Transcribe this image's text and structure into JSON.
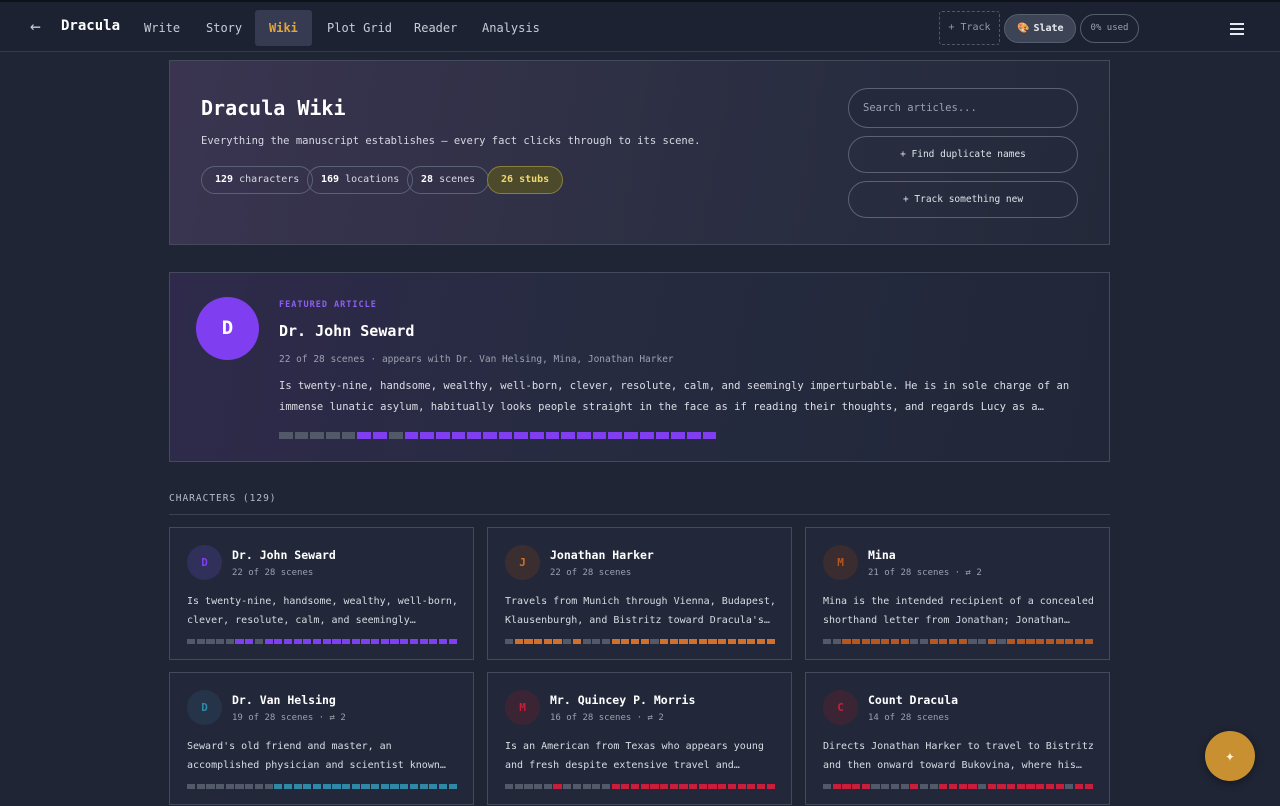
{
  "topbar": {
    "back_glyph": "←",
    "title": "Dracula",
    "tabs": [
      {
        "label": "Write",
        "active": false
      },
      {
        "label": "Story",
        "active": false
      },
      {
        "label": "Wiki",
        "active": true
      },
      {
        "label": "Plot Grid",
        "active": false
      },
      {
        "label": "Reader",
        "active": false
      },
      {
        "label": "Analysis",
        "active": false
      }
    ],
    "track_label": "+ Track",
    "theme_label": "Slate",
    "theme_icon": "palette-icon",
    "usage_label": "0% used",
    "menu_icon": "hamburger-menu-icon"
  },
  "hero": {
    "title": "Dracula Wiki",
    "subtitle": "Everything the manuscript establishes — every fact clicks through to its scene.",
    "stats": [
      {
        "count": "129",
        "label": "characters"
      },
      {
        "count": "169",
        "label": "locations"
      },
      {
        "count": "28",
        "label": "scenes"
      }
    ],
    "stubs": {
      "count": "26",
      "label": "stubs"
    },
    "search_placeholder": "Search articles...",
    "find_duplicates_label": "+ Find duplicate names",
    "track_new_label": "+ Track something new"
  },
  "featured": {
    "kicker": "FEATURED ARTICLE",
    "initial": "D",
    "name": "Dr. John Seward",
    "meta": "22 of 28 scenes · appears with Dr. Van Helsing, Mina, Jonathan Harker",
    "description": "Is twenty-nine, handsome, wealthy, well-born, clever, resolute, calm, and seemingly imperturbable. He is in sole charge of an immense lunatic asylum, habitually looks people straight in the face as if reading their thoughts, and regards Lucy as a curious psychological study. He proposes t…",
    "color": "#7f3ff0",
    "scenes": [
      0,
      0,
      0,
      0,
      0,
      1,
      1,
      0,
      1,
      1,
      1,
      1,
      1,
      1,
      1,
      1,
      1,
      1,
      1,
      1,
      1,
      1,
      1,
      1,
      1,
      1,
      1,
      1
    ]
  },
  "characters_section": {
    "label": "CHARACTERS (129)"
  },
  "characters": [
    {
      "initial": "D",
      "name": "Dr. John Seward",
      "meta": "22 of 28 scenes",
      "description": "Is twenty-nine, handsome, wealthy, well-born, clever, resolute, calm, and seemingly imperturbable. He is in sole charge of an immense lunatic asylum…",
      "color": "#7f3ff0",
      "avatar_bg": "#30305a",
      "scenes": [
        0,
        0,
        0,
        0,
        0,
        1,
        1,
        0,
        1,
        1,
        1,
        1,
        1,
        1,
        1,
        1,
        1,
        1,
        1,
        1,
        1,
        1,
        1,
        1,
        1,
        1,
        1,
        1
      ]
    },
    {
      "initial": "J",
      "name": "Jonathan Harker",
      "meta": "22 of 28 scenes",
      "description": "Travels from Munich through Vienna, Budapest, Klausenburgh, and Bistritz toward Dracula's castle…",
      "color": "#d0702a",
      "avatar_bg": "#3b2e31",
      "scenes": [
        0,
        1,
        1,
        1,
        1,
        1,
        0,
        1,
        0,
        0,
        0,
        1,
        1,
        1,
        1,
        0,
        1,
        1,
        1,
        1,
        1,
        1,
        1,
        1,
        1,
        1,
        1,
        1
      ]
    },
    {
      "initial": "M",
      "name": "Mina",
      "meta": "21 of 28 scenes · ⇄ 2",
      "description": "Mina is the intended recipient of a concealed shorthand letter from Jonathan; Jonathan worries that…",
      "color": "#b5571f",
      "avatar_bg": "#3a2c2f",
      "scenes": [
        0,
        0,
        1,
        1,
        1,
        1,
        1,
        1,
        1,
        0,
        0,
        1,
        1,
        1,
        1,
        0,
        0,
        1,
        0,
        1,
        1,
        1,
        1,
        1,
        1,
        1,
        1,
        1
      ]
    },
    {
      "initial": "D",
      "name": "Dr. Van Helsing",
      "meta": "19 of 28 scenes · ⇄ 2",
      "description": "Seward's old friend and master, an accomplished physician and scientist known for intellectual…",
      "color": "#2f88a6",
      "avatar_bg": "#26344a",
      "scenes": [
        0,
        0,
        0,
        0,
        0,
        0,
        0,
        0,
        0,
        1,
        1,
        1,
        1,
        1,
        1,
        1,
        1,
        1,
        1,
        1,
        1,
        1,
        1,
        1,
        1,
        1,
        1,
        1
      ]
    },
    {
      "initial": "M",
      "name": "Mr. Quincey P. Morris",
      "meta": "16 of 28 scenes · ⇄ 2",
      "description": "Is an American from Texas who appears young and fresh despite extensive travel and adventures. He is well…",
      "color": "#c81e3c",
      "avatar_bg": "#3b2535",
      "scenes": [
        0,
        0,
        0,
        0,
        0,
        1,
        0,
        0,
        0,
        0,
        0,
        1,
        1,
        1,
        1,
        1,
        1,
        1,
        1,
        1,
        1,
        1,
        1,
        1,
        1,
        1,
        1,
        1
      ]
    },
    {
      "initial": "C",
      "name": "Count Dracula",
      "meta": "14 of 28 scenes",
      "description": "Directs Jonathan Harker to travel to Bistritz and then onward toward Bukovina, where his carriage is…",
      "color": "#c81e3c",
      "avatar_bg": "#3b2535",
      "scenes": [
        0,
        1,
        1,
        1,
        1,
        0,
        0,
        0,
        0,
        1,
        0,
        0,
        1,
        1,
        1,
        1,
        0,
        1,
        1,
        1,
        1,
        1,
        1,
        1,
        1,
        0,
        1,
        1
      ]
    }
  ],
  "fab": {
    "glyph": "✦",
    "icon": "sparkle-icon"
  }
}
